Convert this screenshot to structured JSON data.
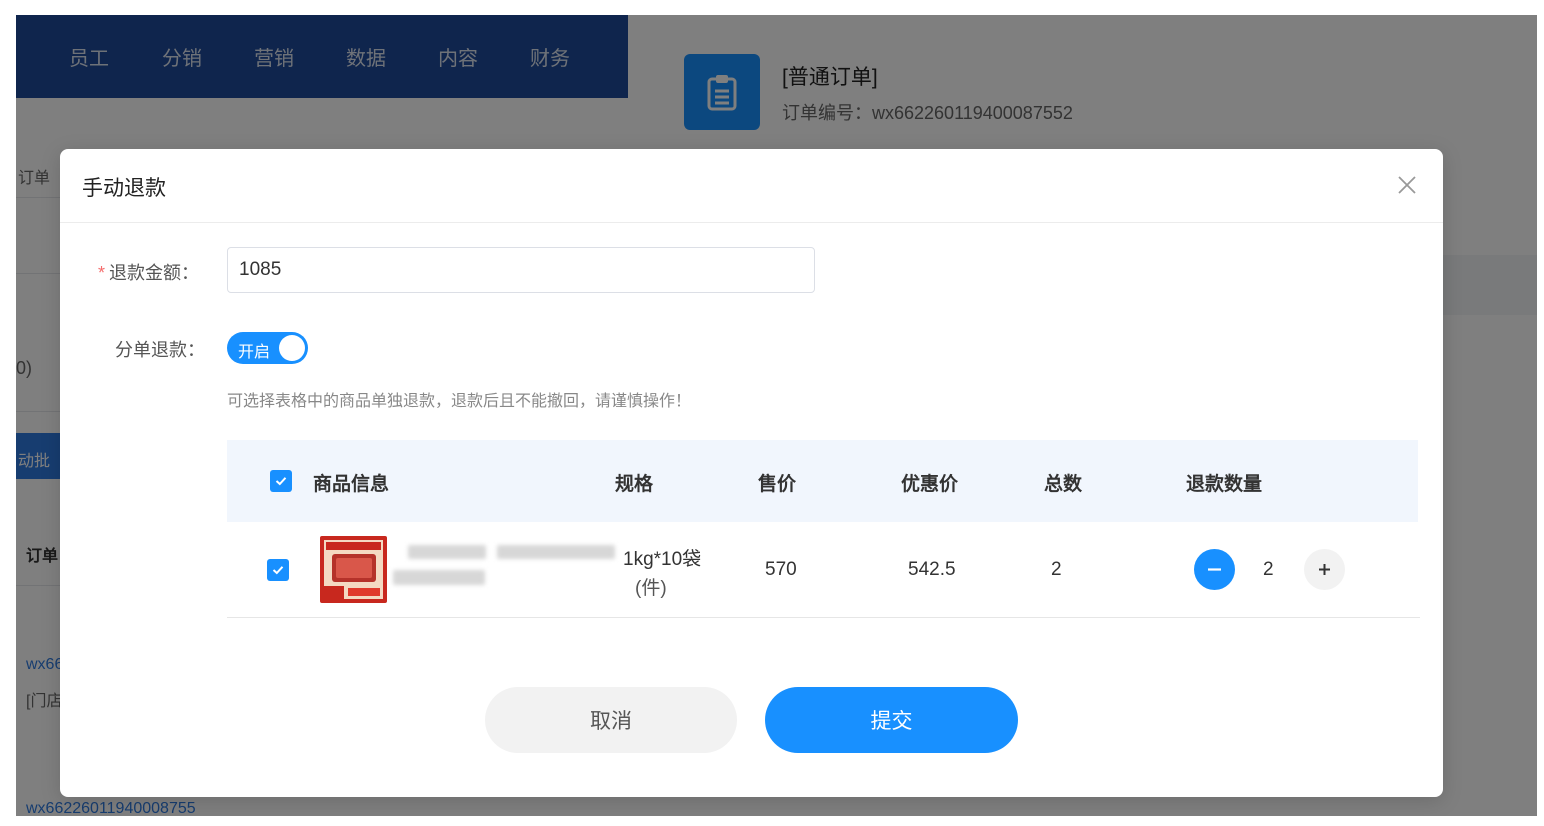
{
  "background": {
    "nav_items": [
      "员工",
      "分销",
      "营销",
      "数据",
      "内容",
      "财务"
    ],
    "left_fragments": {
      "tab_fragment": "订单",
      "count_fragment": "0)",
      "batch_button_fragment": "动批",
      "column_fragment": "订单",
      "order_link_fragment": "wx66",
      "store_fragment": "[门店",
      "bottom_order_no": "wx66226011940008755"
    },
    "order_panel": {
      "title": "[普通订单]",
      "order_no": "订单编号：wx662260119400087552"
    }
  },
  "modal": {
    "title": "手动退款",
    "refund_amount": {
      "required_mark": "*",
      "label": "退款金额：",
      "value": "1085"
    },
    "split_refund": {
      "label": "分单退款：",
      "switch_text": "开启",
      "enabled": true
    },
    "hint": "可选择表格中的商品单独退款，退款后且不能撤回，请谨慎操作！",
    "table": {
      "headers": {
        "product": "商品信息",
        "spec": "规格",
        "price": "售价",
        "discount_price": "优惠价",
        "total": "总数",
        "refund_qty": "退款数量"
      },
      "rows": [
        {
          "checked": true,
          "spec_line1": "1kg*10袋",
          "spec_line2": "(件)",
          "price": "570",
          "discount_price": "542.5",
          "total": "2",
          "refund_qty": "2"
        }
      ]
    },
    "buttons": {
      "cancel": "取消",
      "submit": "提交"
    }
  },
  "colors": {
    "primary": "#1890ff",
    "nav_bg": "#1f4a9a",
    "required": "#f56c6c"
  }
}
